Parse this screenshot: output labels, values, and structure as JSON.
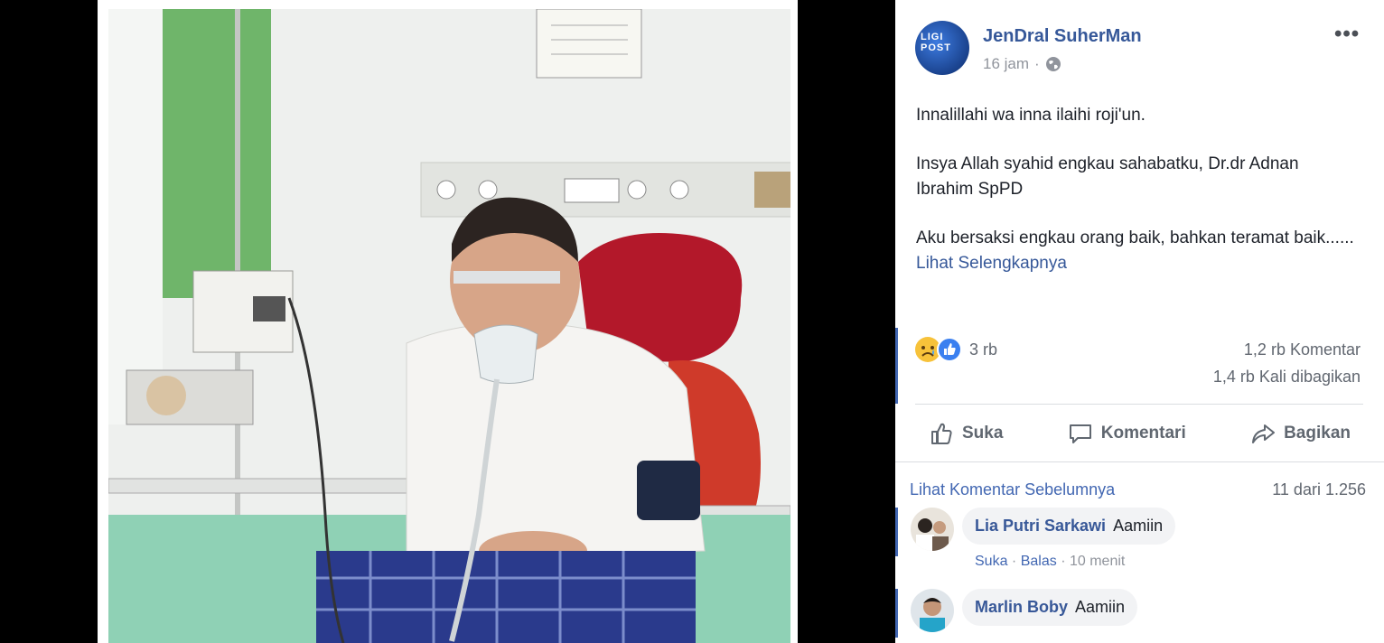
{
  "post": {
    "author": "JenDral SuherMan",
    "avatar_text": "LIGI POST",
    "time": "16 jam",
    "time_sep": "·",
    "more_label": "•••",
    "paragraphs": [
      "Innalillahi wa inna ilaihi roji'un.",
      "Insya Allah syahid engkau sahabatku, Dr.dr Adnan Ibrahim SpPD",
      "Aku bersaksi engkau orang baik, bahkan teramat baik......"
    ],
    "see_more": "Lihat Selengkapnya"
  },
  "stats": {
    "reactions_count": "3 rb",
    "comments": "1,2 rb Komentar",
    "shares": "1,4 rb Kali dibagikan"
  },
  "actions": {
    "like": "Suka",
    "comment": "Komentari",
    "share": "Bagikan"
  },
  "comments": {
    "prev_label": "Lihat Komentar Sebelumnya",
    "count_label": "11 dari 1.256",
    "items": [
      {
        "name": "Lia Putri Sarkawi",
        "text": "Aamiin",
        "like": "Suka",
        "reply": "Balas",
        "time": "10 menit"
      },
      {
        "name": "Marlin Boby",
        "text": "Aamiin"
      }
    ]
  },
  "colors": {
    "link": "#365899",
    "accent": "#4267b2",
    "muted": "#90949c"
  }
}
